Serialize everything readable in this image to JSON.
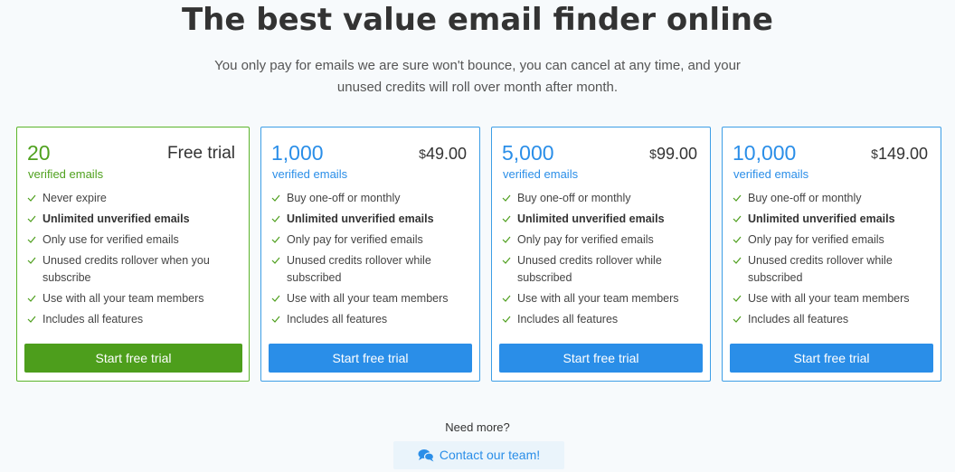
{
  "header": {
    "title": "The best value email finder online",
    "subtitle_line1": "You only pay for emails we are sure won't bounce, you can cancel at any time, and your",
    "subtitle_line2": "unused credits will roll over month after month."
  },
  "plans": [
    {
      "quantity": "20",
      "unit": "verified emails",
      "price": "Free trial",
      "features": [
        "Never expire",
        "Unlimited unverified emails",
        "Only use for verified emails",
        "Unused credits rollover when you",
        "subscribe",
        "Use with all your team members",
        "Includes all features"
      ],
      "cta": "Start free trial"
    },
    {
      "quantity": "1,000",
      "unit": "verified emails",
      "currency": "$",
      "price": "49.00",
      "features": [
        "Buy one-off or monthly",
        "Unlimited unverified emails",
        "Only pay for verified emails",
        "Unused credits rollover while",
        "subscribed",
        "Use with all your team members",
        "Includes all features"
      ],
      "cta": "Start free trial"
    },
    {
      "quantity": "5,000",
      "unit": "verified emails",
      "currency": "$",
      "price": "99.00",
      "features": [
        "Buy one-off or monthly",
        "Unlimited unverified emails",
        "Only pay for verified emails",
        "Unused credits rollover while",
        "subscribed",
        "Use with all your team members",
        "Includes all features"
      ],
      "cta": "Start free trial"
    },
    {
      "quantity": "10,000",
      "unit": "verified emails",
      "currency": "$",
      "price": "149.00",
      "features": [
        "Buy one-off or monthly",
        "Unlimited unverified emails",
        "Only pay for verified emails",
        "Unused credits rollover while",
        "subscribed",
        "Use with all your team members",
        "Includes all features"
      ],
      "cta": "Start free trial"
    }
  ],
  "footer": {
    "need_more": "Need more?",
    "contact": "Contact our team!",
    "contact_icon": "chat-bubbles-icon"
  },
  "colors": {
    "primary_blue": "#2a8ee8",
    "free_green": "#4d9e1c",
    "check_gray": "#6c8a5c"
  }
}
